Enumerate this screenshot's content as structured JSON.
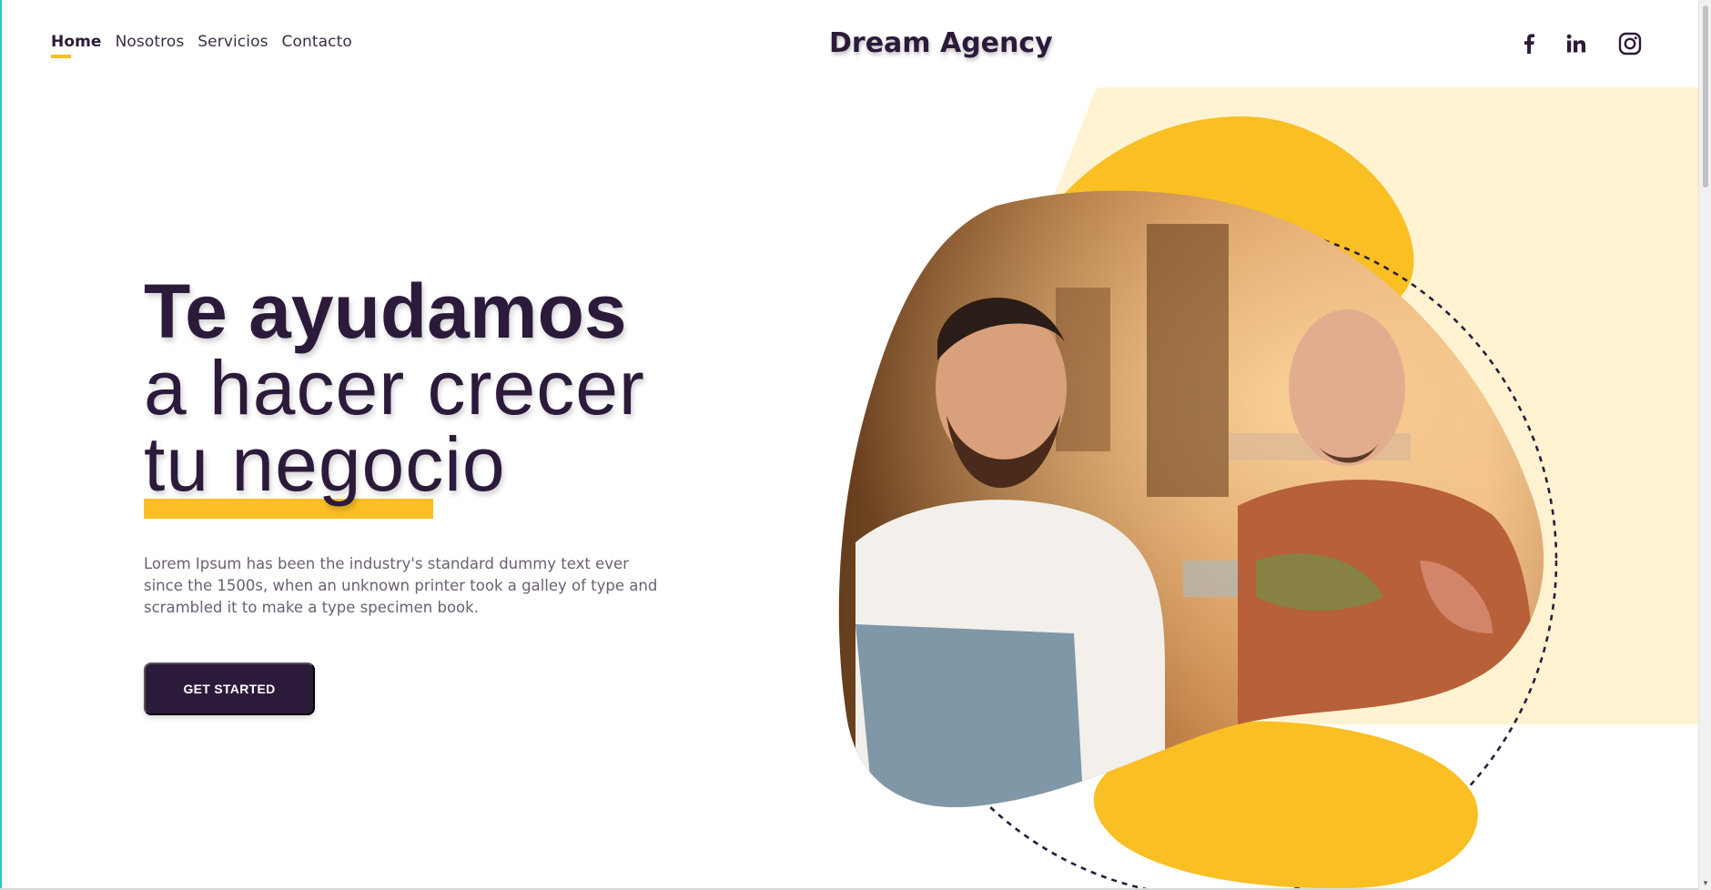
{
  "nav": {
    "items": [
      {
        "label": "Home",
        "active": true
      },
      {
        "label": "Nosotros",
        "active": false
      },
      {
        "label": "Servicios",
        "active": false
      },
      {
        "label": "Contacto",
        "active": false
      }
    ]
  },
  "brand": {
    "name": "Dream Agency"
  },
  "social": {
    "icons": [
      "facebook-icon",
      "linkedin-icon",
      "instagram-icon"
    ]
  },
  "hero": {
    "headline_line1": "Te ayudamos",
    "headline_line2": "a hacer crecer",
    "headline_line3": "tu negocio",
    "description": "Lorem Ipsum has been the industry's standard dummy text ever since the 1500s, when an unknown printer took a galley of type and scrambled it to make a type specimen book.",
    "cta_label": "GET STARTED"
  },
  "colors": {
    "primary": "#2c1a3b",
    "accent": "#f9bf23",
    "accent_light": "#fff3d1",
    "text_muted": "#6b5f74"
  }
}
